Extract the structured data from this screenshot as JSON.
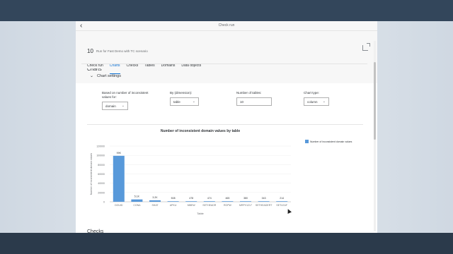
{
  "shell": {
    "title": "Check run"
  },
  "header": {
    "run_id": "10",
    "run_name": "Run for Fast Demo with TC scenario"
  },
  "tabs": [
    {
      "label": "Check run",
      "active": false
    },
    {
      "label": "Charts",
      "active": true
    },
    {
      "label": "Checks",
      "active": false
    },
    {
      "label": "Tables",
      "active": false
    },
    {
      "label": "Domains",
      "active": false
    },
    {
      "label": "Data objects",
      "active": false
    }
  ],
  "section_title": "Charts",
  "chart_settings": {
    "title": "Chart settings",
    "based_on": {
      "label": "Based on number of inconsistent values for:",
      "value": "domain"
    },
    "by_dimension": {
      "label": "By (dimension):",
      "value": "table"
    },
    "number_of_tables": {
      "label": "Number of tables:",
      "value": "10"
    },
    "chart_type": {
      "label": "Chart type:",
      "value": "column"
    }
  },
  "checks_heading": "Checks",
  "colors": {
    "accent": "#0a6ed1",
    "bar": "#5899da"
  },
  "chart_data": {
    "type": "bar",
    "title": "Number of inconsistent domain values by table",
    "xlabel": "Table",
    "ylabel": "Number of inconsistent domain values",
    "ylim": [
      0,
      120000
    ],
    "yticks": [
      "0",
      "20000",
      "40000",
      "60000",
      "80000",
      "100000",
      "120000"
    ],
    "yticks_values": [
      0,
      20000,
      40000,
      60000,
      80000,
      100000,
      120000
    ],
    "legend_position": "top-right",
    "categories": [
      "DOUID",
      "CONA",
      "SHAT",
      "APKU",
      "MBEW",
      "SETHEADR",
      "ROPW",
      "MRPV1217",
      "SETHEADERT",
      "SETLEAF"
    ],
    "series": [
      {
        "name": "Number of inconsistent domain values",
        "values": [
          99000,
          5100,
          3200,
          508,
          478,
          474,
          465,
          380,
          343,
          214
        ],
        "labels": [
          "99K",
          "5.1K",
          "3.2K",
          "508",
          "478",
          "474",
          "465",
          "380",
          "343",
          "214"
        ]
      }
    ]
  }
}
